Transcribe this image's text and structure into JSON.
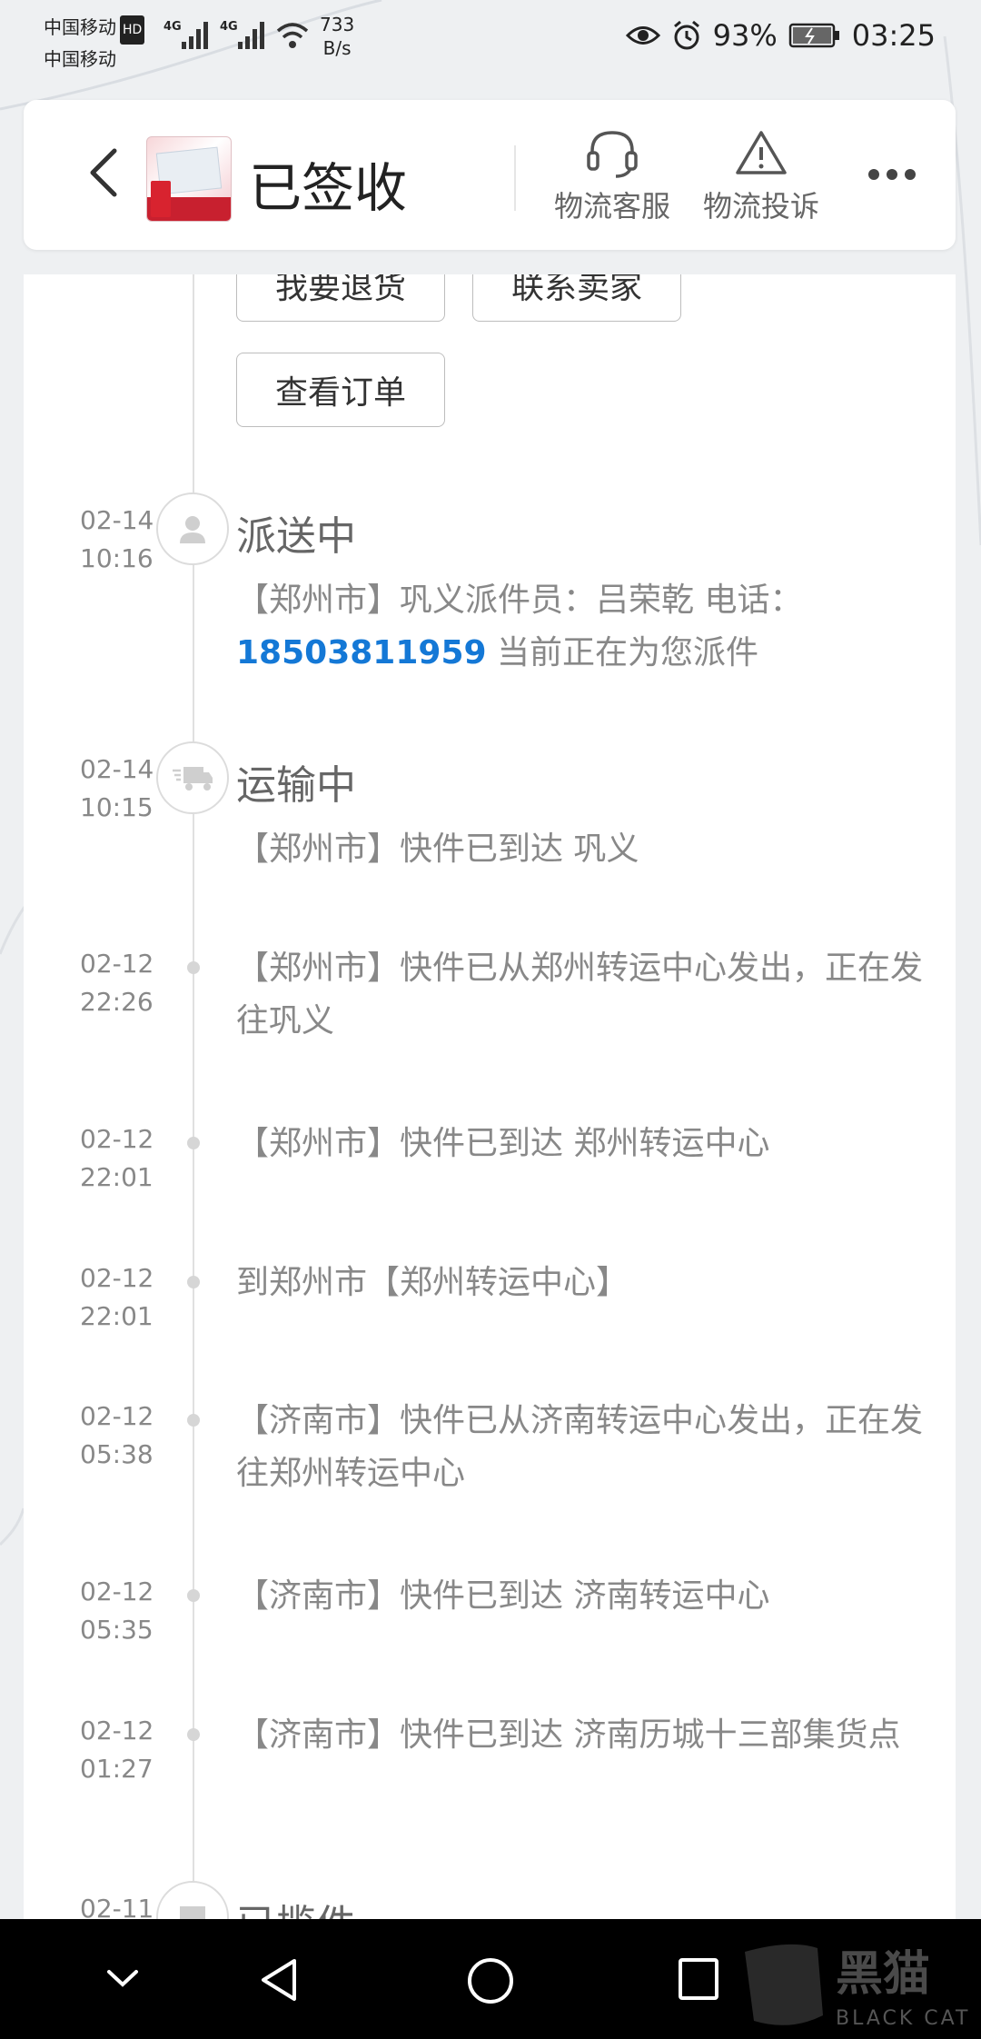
{
  "status_bar": {
    "carrier1": "中国移动",
    "carrier2": "中国移动",
    "hd": "HD",
    "net1": "4G",
    "net2": "4G",
    "speed_value": "733",
    "speed_unit": "B/s",
    "battery": "93%",
    "time": "03:25"
  },
  "header": {
    "title": "已签收",
    "service_label": "物流客服",
    "complaint_label": "物流投诉"
  },
  "actions": {
    "return_label": "我要退货",
    "contact_label": "联系卖家",
    "order_label": "查看订单"
  },
  "timeline": [
    {
      "date": "02-14",
      "time": "10:16",
      "status": "派送中",
      "desc_prefix": "【郑州市】巩义派件员：吕荣乾 电话：",
      "phone": "18503811959",
      "desc_suffix": " 当前正在为您派件"
    },
    {
      "date": "02-14",
      "time": "10:15",
      "status": "运输中",
      "desc": "【郑州市】快件已到达 巩义"
    },
    {
      "date": "02-12",
      "time": "22:26",
      "desc": "【郑州市】快件已从郑州转运中心发出，正在发往巩义"
    },
    {
      "date": "02-12",
      "time": "22:01",
      "desc": "【郑州市】快件已到达 郑州转运中心"
    },
    {
      "date": "02-12",
      "time": "22:01",
      "desc": "到郑州市【郑州转运中心】"
    },
    {
      "date": "02-12",
      "time": "05:38",
      "desc": "【济南市】快件已从济南转运中心发出，正在发往郑州转运中心"
    },
    {
      "date": "02-12",
      "time": "05:35",
      "desc": "【济南市】快件已到达 济南转运中心"
    },
    {
      "date": "02-12",
      "time": "01:27",
      "desc": "【济南市】快件已到达 济南历城十三部集货点"
    },
    {
      "date": "02-11",
      "time": "",
      "status": "已揽件"
    }
  ],
  "watermark": {
    "cn": "黑猫",
    "en": "BLACK CAT"
  }
}
